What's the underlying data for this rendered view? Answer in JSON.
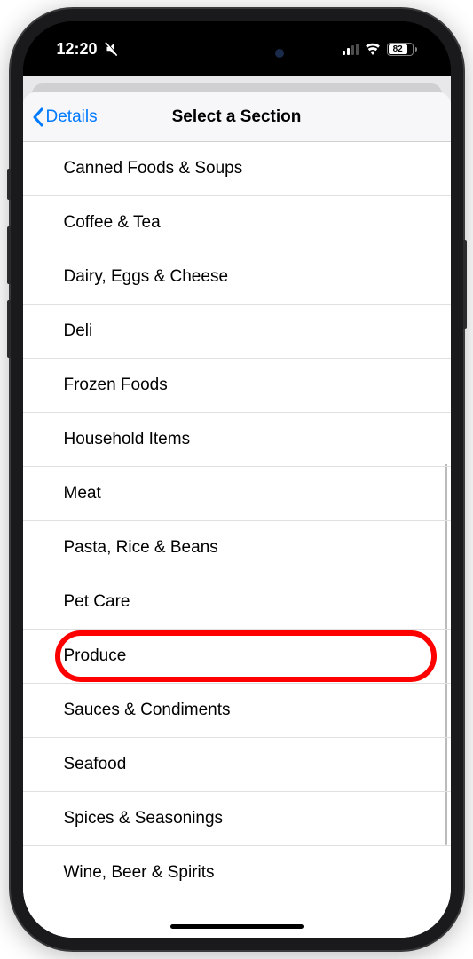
{
  "status_bar": {
    "time": "12:20",
    "battery_percent": "82",
    "battery_width": "82%"
  },
  "nav": {
    "back_label": "Details",
    "title": "Select a Section"
  },
  "sections": [
    {
      "label": "Canned Foods & Soups",
      "highlighted": false
    },
    {
      "label": "Coffee & Tea",
      "highlighted": false
    },
    {
      "label": "Dairy, Eggs & Cheese",
      "highlighted": false
    },
    {
      "label": "Deli",
      "highlighted": false
    },
    {
      "label": "Frozen Foods",
      "highlighted": false
    },
    {
      "label": "Household Items",
      "highlighted": false
    },
    {
      "label": "Meat",
      "highlighted": false
    },
    {
      "label": "Pasta, Rice & Beans",
      "highlighted": false
    },
    {
      "label": "Pet Care",
      "highlighted": false
    },
    {
      "label": "Produce",
      "highlighted": true
    },
    {
      "label": "Sauces & Condiments",
      "highlighted": false
    },
    {
      "label": "Seafood",
      "highlighted": false
    },
    {
      "label": "Spices & Seasonings",
      "highlighted": false
    },
    {
      "label": "Wine, Beer & Spirits",
      "highlighted": false
    }
  ]
}
